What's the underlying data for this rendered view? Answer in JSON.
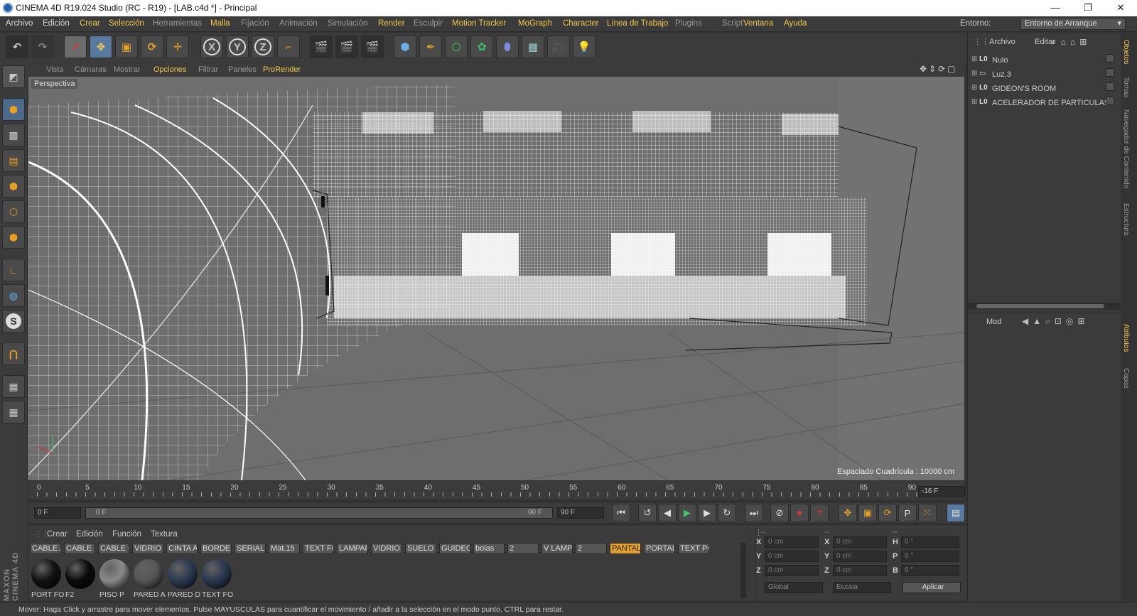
{
  "window": {
    "title": "CINEMA 4D R19.024 Studio (RC - R19) - [LAB.c4d *] - Principal",
    "min": "—",
    "max": "❐",
    "close": "✕"
  },
  "menu": [
    {
      "label": "Archivo",
      "style": "w"
    },
    {
      "label": "Edición",
      "style": "w"
    },
    {
      "label": "Crear",
      "style": "y"
    },
    {
      "label": "Selección",
      "style": "y"
    },
    {
      "label": "Herramientas",
      "style": "g"
    },
    {
      "label": "Malla",
      "style": "y"
    },
    {
      "label": "Fijación",
      "style": "g"
    },
    {
      "label": "Animación",
      "style": "g"
    },
    {
      "label": "Simulación",
      "style": "g"
    },
    {
      "label": "Render",
      "style": "y"
    },
    {
      "label": "Esculpir",
      "style": "g"
    },
    {
      "label": "Motion Tracker",
      "style": "y"
    },
    {
      "label": "MoGraph",
      "style": "y"
    },
    {
      "label": "Character",
      "style": "y"
    },
    {
      "label": "Línea de Trabajo",
      "style": "y"
    },
    {
      "label": "Plugins",
      "style": "g"
    },
    {
      "label": "Script",
      "style": "g"
    },
    {
      "label": "Ventana",
      "style": "y"
    },
    {
      "label": "Ayuda",
      "style": "y"
    }
  ],
  "environment": {
    "label": "Entorno:",
    "value": "Entorno de Arranque"
  },
  "toolbar": {
    "axis_x": "X",
    "axis_y": "Y",
    "axis_z": "Z"
  },
  "viewport_menu": [
    {
      "label": "Vista",
      "style": ""
    },
    {
      "label": "Cámaras",
      "style": ""
    },
    {
      "label": "Mostrar",
      "style": ""
    },
    {
      "label": "Opciones",
      "style": "y"
    },
    {
      "label": "Filtrar",
      "style": ""
    },
    {
      "label": "Paneles",
      "style": ""
    },
    {
      "label": "ProRender",
      "style": "y"
    }
  ],
  "viewport": {
    "camera": "Perspectiva",
    "grid_spacing": "Espaciado Cuadrícula : 10000 cm"
  },
  "timeline": {
    "ticks": [
      "0",
      "5",
      "10",
      "15",
      "20",
      "25",
      "30",
      "35",
      "40",
      "45",
      "50",
      "55",
      "60",
      "65",
      "70",
      "75",
      "80",
      "85",
      "90"
    ],
    "current_frame": "-16 F"
  },
  "transport": {
    "start": "0 F",
    "slider_left": "0 F",
    "slider_right": "90 F",
    "end": "90 F"
  },
  "materials": {
    "menu": [
      "Crear",
      "Edición",
      "Función",
      "Textura"
    ],
    "tabs": [
      {
        "label": "CABLE A"
      },
      {
        "label": "CABLE N"
      },
      {
        "label": "CABLE c"
      },
      {
        "label": "VIDRIO"
      },
      {
        "label": "CINTA A"
      },
      {
        "label": "BORDE"
      },
      {
        "label": "SERIAL"
      },
      {
        "label": "Mat.15"
      },
      {
        "label": "TEXT FO"
      },
      {
        "label": "LAMPAR"
      },
      {
        "label": "VIDRIO"
      },
      {
        "label": "SUELO ("
      },
      {
        "label": "GUIDEO"
      },
      {
        "label": "bolas"
      },
      {
        "label": "2"
      },
      {
        "label": "V LAMP"
      },
      {
        "label": "2"
      },
      {
        "label": "PANTAL",
        "highlight": true
      },
      {
        "label": "PORTAL"
      },
      {
        "label": "TEXT PO"
      }
    ],
    "balls": [
      {
        "label": "PORT FO",
        "color": "#111111"
      },
      {
        "label": "F2",
        "color": "#0a0a0a"
      },
      {
        "label": "PISO P",
        "color": "#8a8a8a"
      },
      {
        "label": "PARED A",
        "color": "#555555"
      },
      {
        "label": "PARED D",
        "color": "#2c3a52"
      },
      {
        "label": "TEXT FO",
        "color": "#2a3850"
      }
    ]
  },
  "coords": {
    "headers": [
      "--",
      "--",
      "--"
    ],
    "rows": [
      {
        "l1": "X",
        "v1": "0 cm",
        "l2": "X",
        "v2": "0 cm",
        "l3": "H",
        "v3": "0 °"
      },
      {
        "l1": "Y",
        "v1": "0 cm",
        "l2": "Y",
        "v2": "0 cm",
        "l3": "P",
        "v3": "0 °"
      },
      {
        "l1": "Z",
        "v1": "0 cm",
        "l2": "Z",
        "v2": "0 cm",
        "l3": "B",
        "v3": "0 °"
      }
    ],
    "mode1": "Global",
    "mode2": "Escala",
    "apply": "Aplicar"
  },
  "objects": {
    "menu": [
      "Archivo",
      "Editar"
    ],
    "items": [
      {
        "label": "Nulo"
      },
      {
        "label": "Luz.3"
      },
      {
        "label": "GIDEON'S ROOM"
      },
      {
        "label": "ACELERADOR DE PARTICULAS"
      }
    ]
  },
  "attributes": {
    "mode": "Mod"
  },
  "right_tabs": [
    {
      "label": "Objetos",
      "on": true
    },
    {
      "label": "Tomas",
      "on": false
    },
    {
      "label": "Navegador de Contenido",
      "on": false
    },
    {
      "label": "Estructura",
      "on": false
    },
    {
      "label": "Atributos",
      "on": true
    },
    {
      "label": "Capas",
      "on": false
    }
  ],
  "brand": "MAXON CINEMA 4D",
  "status": "Mover: Haga Click y arrastre para mover elementos. Pulse MAYUSCULAS para cuantificar el movimiento / añadir a la selección en el modo punto. CTRL para restar.",
  "colors": {
    "accent": "#f2c94c",
    "panel": "#3b3b3b",
    "viewport": "#6b6b6b",
    "highlight": "#e8a020"
  }
}
